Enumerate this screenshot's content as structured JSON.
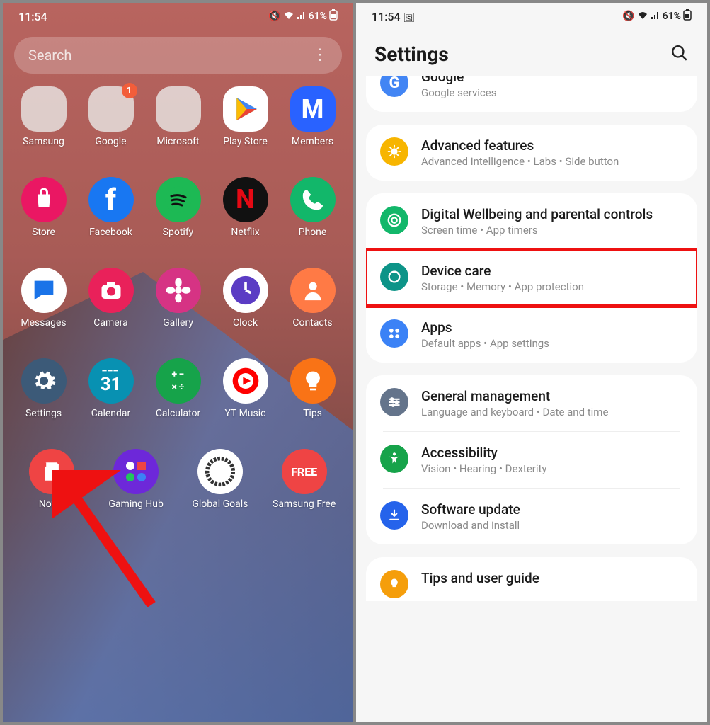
{
  "status": {
    "time": "11:54",
    "battery": "61%"
  },
  "home": {
    "search_placeholder": "Search",
    "rows": [
      [
        {
          "label": "Samsung",
          "type": "folder",
          "colors": [
            "#e53935",
            "#fff",
            "#26c281",
            "#4285f4",
            "#fff",
            "#4285f4",
            "#7e57c2",
            "#26a69a",
            "#ff7043"
          ]
        },
        {
          "label": "Google",
          "type": "folder",
          "badge": "1",
          "colors": [
            "#4285f4",
            "#ea4335",
            "#fff",
            "#34a853",
            "#fbbc05",
            "#0f9d58",
            "#ea4335",
            "#fff",
            "#fff"
          ]
        },
        {
          "label": "Microsoft",
          "type": "folder",
          "colors": [
            "#0078d4",
            "#28a8ea",
            "#0072c6",
            "",
            "",
            "",
            "",
            "",
            ""
          ]
        },
        {
          "label": "Play Store",
          "bg": "#ffffff",
          "glyph": "▶",
          "glyphColor": "linear"
        },
        {
          "label": "Members",
          "bg": "#2962ff",
          "glyph": "M"
        }
      ],
      [
        {
          "label": "Store",
          "bg": "#ea1763",
          "glyph": "shop",
          "round": true
        },
        {
          "label": "Facebook",
          "bg": "#1877f2",
          "glyph": "f",
          "round": true
        },
        {
          "label": "Spotify",
          "bg": "#1db954",
          "glyph": "spotify",
          "round": true
        },
        {
          "label": "Netflix",
          "bg": "#111",
          "glyph": "N",
          "glyphColor": "#e50914",
          "round": true
        },
        {
          "label": "Phone",
          "bg": "#12b76a",
          "glyph": "phone",
          "round": true
        }
      ],
      [
        {
          "label": "Messages",
          "bg": "#fff",
          "glyph": "chat",
          "glyphColor": "#1a73e8",
          "round": true
        },
        {
          "label": "Camera",
          "bg": "#e9215a",
          "glyph": "camera",
          "round": true
        },
        {
          "label": "Gallery",
          "bg": "#d63384",
          "glyph": "flower",
          "round": true
        },
        {
          "label": "Clock",
          "bg": "#fff",
          "glyph": "clock",
          "glyphColor": "#5b3cc4",
          "round": true
        },
        {
          "label": "Contacts",
          "bg": "#ff7a45",
          "glyph": "person",
          "round": true
        }
      ],
      [
        {
          "label": "Settings",
          "bg": "#3c5a78",
          "glyph": "gear",
          "round": true
        },
        {
          "label": "Calendar",
          "bg": "#0891b2",
          "glyph": "31",
          "round": true
        },
        {
          "label": "Calculator",
          "bg": "#16a34a",
          "glyph": "calc",
          "round": true
        },
        {
          "label": "YT Music",
          "bg": "#fff",
          "glyph": "yt",
          "glyphColor": "#ff0000",
          "round": true
        },
        {
          "label": "Tips",
          "bg": "#f97316",
          "glyph": "bulb",
          "round": true
        }
      ],
      [
        {
          "label": "Notes",
          "bg": "#ef4444",
          "glyph": "note",
          "round": true
        },
        {
          "label": "Gaming Hub",
          "bg": "#6d28d9",
          "glyph": "pad",
          "round": true
        },
        {
          "label": "Global Goals",
          "bg": "#fff",
          "glyph": "globe",
          "round": true
        },
        {
          "label": "Samsung Free",
          "bg": "#ef4444",
          "glyph": "FREE",
          "round": true
        }
      ]
    ]
  },
  "settings": {
    "title": "Settings",
    "groups": [
      {
        "partial": "top",
        "items": [
          {
            "title": "Google",
            "sub": "Google services",
            "color": "#4285f4",
            "icon": "G"
          }
        ]
      },
      {
        "items": [
          {
            "title": "Advanced features",
            "sub": "Advanced intelligence  •  Labs  •  Side button",
            "color": "#f7b500",
            "icon": "plus"
          }
        ]
      },
      {
        "items": [
          {
            "title": "Digital Wellbeing and parental controls",
            "sub": "Screen time  •  App timers",
            "color": "#12b76a",
            "icon": "target"
          },
          {
            "title": "Device care",
            "sub": "Storage  •  Memory  •  App protection",
            "color": "#0d9488",
            "icon": "care",
            "highlight": true
          },
          {
            "title": "Apps",
            "sub": "Default apps  •  App settings",
            "color": "#3b82f6",
            "icon": "dots4"
          }
        ]
      },
      {
        "items": [
          {
            "title": "General management",
            "sub": "Language and keyboard  •  Date and time",
            "color": "#64748b",
            "icon": "sliders"
          },
          {
            "title": "Accessibility",
            "sub": "Vision  •  Hearing  •  Dexterity",
            "color": "#16a34a",
            "icon": "a11y"
          },
          {
            "title": "Software update",
            "sub": "Download and install",
            "color": "#2563eb",
            "icon": "dl"
          }
        ]
      },
      {
        "partial": "bottom",
        "items": [
          {
            "title": "Tips and user guide",
            "sub": "",
            "color": "#f59e0b",
            "icon": "bulb"
          }
        ]
      }
    ]
  }
}
